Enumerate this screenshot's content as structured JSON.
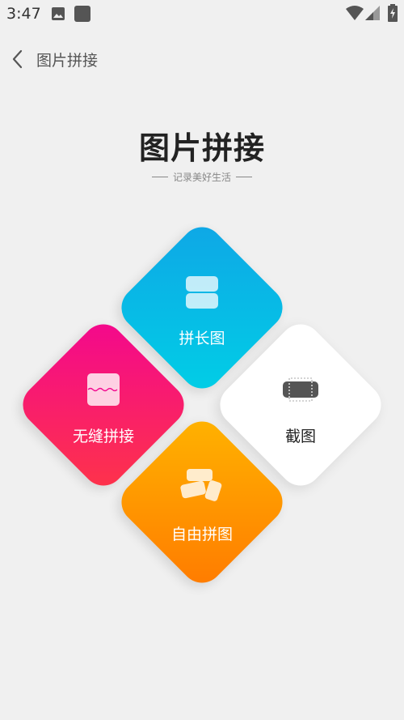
{
  "status_bar": {
    "time": "3:47",
    "icons": [
      "image-icon",
      "app-square-icon",
      "wifi-icon",
      "signal-icon",
      "battery-icon"
    ]
  },
  "app_bar": {
    "back_icon": "chevron-left-icon",
    "title": "图片拼接"
  },
  "hero": {
    "title": "图片拼接",
    "subtitle": "记录美好生活"
  },
  "tiles": {
    "long": {
      "label": "拼长图",
      "icon": "stacked-rows-icon",
      "colors": [
        "#0fa6e6",
        "#00cfe6"
      ]
    },
    "seamless": {
      "label": "无缝拼接",
      "icon": "wave-split-icon",
      "colors": [
        "#f3078f",
        "#fe3448"
      ]
    },
    "screenshot": {
      "label": "截图",
      "icon": "crop-screenshot-icon",
      "colors": [
        "#ffffff"
      ]
    },
    "free": {
      "label": "自由拼图",
      "icon": "scattered-cards-icon",
      "colors": [
        "#ffb400",
        "#ff7a00"
      ]
    }
  }
}
